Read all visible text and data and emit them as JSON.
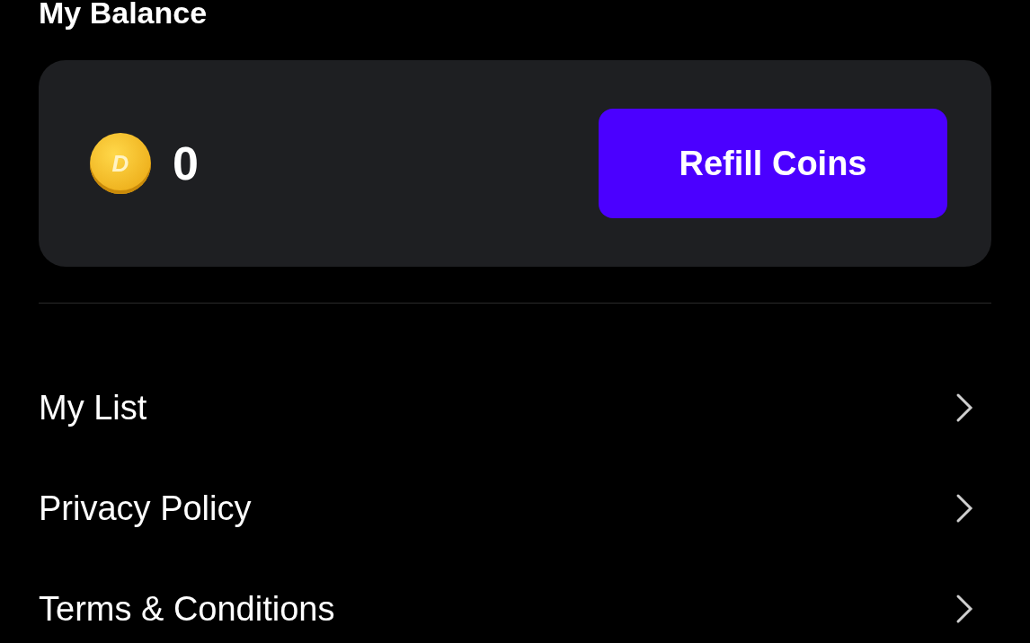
{
  "balance": {
    "title": "My Balance",
    "coin_symbol": "D",
    "amount": "0",
    "button": "Refill Coins"
  },
  "menu": [
    {
      "label": "My List"
    },
    {
      "label": "Privacy Policy"
    },
    {
      "label": "Terms & Conditions"
    }
  ]
}
